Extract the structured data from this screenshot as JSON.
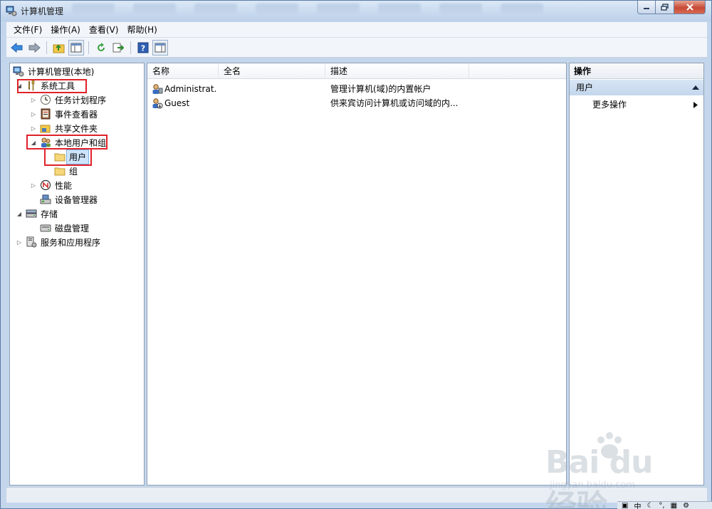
{
  "window": {
    "title": "计算机管理"
  },
  "menu": [
    "文件(F)",
    "操作(A)",
    "查看(V)",
    "帮助(H)"
  ],
  "toolbar": {
    "icons": [
      "back-icon",
      "forward-icon",
      "up-folder-icon",
      "show-hide-tree-icon",
      "refresh-icon",
      "export-icon",
      "help-icon",
      "show-action-pane-icon"
    ]
  },
  "tree": {
    "root": "计算机管理(本地)",
    "system_tools": "系统工具",
    "task_scheduler": "任务计划程序",
    "event_viewer": "事件查看器",
    "shared_folders": "共享文件夹",
    "local_users_groups": "本地用户和组",
    "users": "用户",
    "groups": "组",
    "performance": "性能",
    "device_manager": "设备管理器",
    "storage": "存储",
    "disk_management": "磁盘管理",
    "services_apps": "服务和应用程序"
  },
  "list": {
    "columns": [
      "名称",
      "全名",
      "描述"
    ],
    "rows": [
      {
        "name": "Administrat...",
        "fullname": "",
        "description": "管理计算机(域)的内置帐户"
      },
      {
        "name": "Guest",
        "fullname": "",
        "description": "供来宾访问计算机或访问域的内..."
      }
    ]
  },
  "actions": {
    "header": "操作",
    "section": "用户",
    "more": "更多操作"
  },
  "watermark": {
    "brand": "Bai du 经验",
    "url": "jingyan.baidu.com"
  },
  "taskbar": {
    "ime": "中"
  },
  "colors": {
    "highlight_box": "#e0222a",
    "selection": "#cde4fb"
  }
}
